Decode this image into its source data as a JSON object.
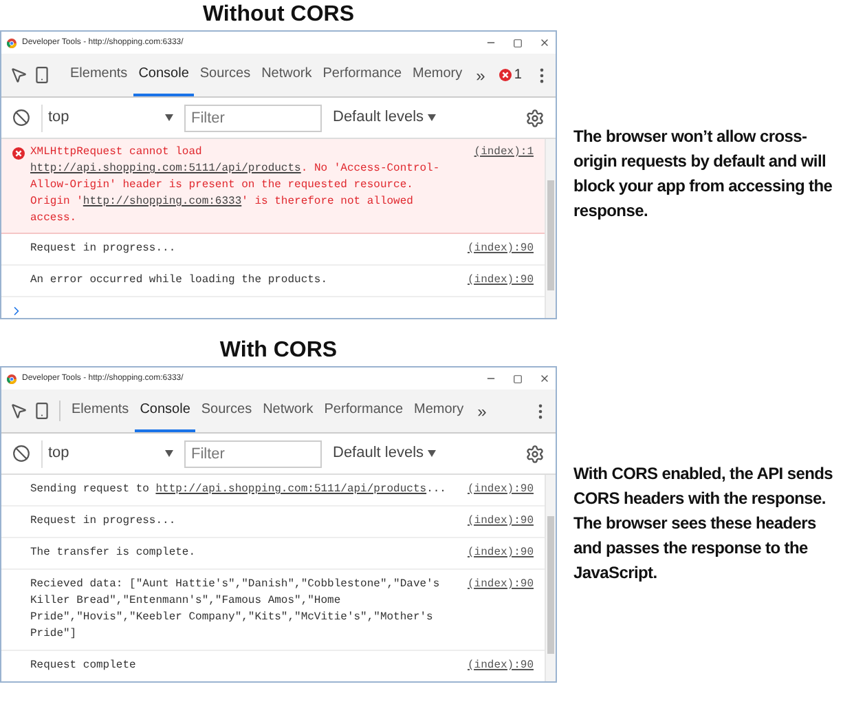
{
  "panels": [
    {
      "heading": "Without CORS",
      "window": {
        "title": "Developer Tools - http://shopping.com:6333/",
        "tabs": [
          {
            "label": "Elements",
            "selected": false
          },
          {
            "label": "Console",
            "selected": true
          },
          {
            "label": "Sources",
            "selected": false
          },
          {
            "label": "Network",
            "selected": false
          },
          {
            "label": "Performance",
            "selected": false
          },
          {
            "label": "Memory",
            "selected": false
          }
        ],
        "more": "»",
        "error_count": "1",
        "context": "top",
        "filter_placeholder": "Filter",
        "levels": "Default levels",
        "log": [
          {
            "kind": "error",
            "segments": [
              {
                "kind": "text",
                "text": "XMLHttpRequest cannot load "
              },
              {
                "kind": "link",
                "text": "http://api.shopping.com:5111/api/products"
              },
              {
                "kind": "text",
                "text": ". No 'Access-Control-Allow-Origin' header is present on the requested resource. Origin '"
              },
              {
                "kind": "link",
                "text": "http://shopping.com:6333"
              },
              {
                "kind": "text",
                "text": "' is therefore not allowed access."
              }
            ],
            "source": "(index):1"
          },
          {
            "kind": "info",
            "segments": [
              {
                "text": "Request in progress..."
              }
            ],
            "source": "(index):90"
          },
          {
            "kind": "info",
            "segments": [
              {
                "text": "An error occurred while loading the products."
              }
            ],
            "source": "(index):90"
          }
        ],
        "prompt": true
      },
      "annotation": "The browser won’t allow cross-origin requests by default and will block your app from accessing the response."
    },
    {
      "heading": "With CORS",
      "window": {
        "title": "Developer Tools - http://shopping.com:6333/",
        "tabs": [
          {
            "label": "Elements",
            "selected": false
          },
          {
            "label": "Console",
            "selected": true
          },
          {
            "label": "Sources",
            "selected": false
          },
          {
            "label": "Network",
            "selected": false
          },
          {
            "label": "Performance",
            "selected": false
          },
          {
            "label": "Memory",
            "selected": false
          }
        ],
        "more": "»",
        "context": "top",
        "filter_placeholder": "Filter",
        "levels": "Default levels",
        "log": [
          {
            "kind": "info",
            "segments": [
              {
                "kind": "text",
                "text": "Sending request to "
              },
              {
                "kind": "link",
                "text": "http://api.shopping.com:5111/api/products"
              },
              {
                "kind": "text",
                "text": "..."
              }
            ],
            "source": "(index):90"
          },
          {
            "kind": "info",
            "segments": [
              {
                "text": "Request in progress..."
              }
            ],
            "source": "(index):90"
          },
          {
            "kind": "info",
            "segments": [
              {
                "text": "The transfer is complete."
              }
            ],
            "source": "(index):90"
          },
          {
            "kind": "info",
            "segments": [
              {
                "text": "Recieved data: [\"Aunt Hattie's\",\"Danish\",\"Cobblestone\",\"Dave's Killer Bread\",\"Entenmann's\",\"Famous Amos\",\"Home Pride\",\"Hovis\",\"Keebler Company\",\"Kits\",\"McVitie's\",\"Mother's Pride\"]"
              }
            ],
            "source": "(index):90"
          },
          {
            "kind": "info",
            "segments": [
              {
                "text": "Request complete"
              }
            ],
            "source": "(index):90"
          }
        ]
      },
      "annotation": "With CORS enabled, the API sends CORS headers with the response. The browser sees these headers and passes the response to the JavaScript."
    }
  ]
}
